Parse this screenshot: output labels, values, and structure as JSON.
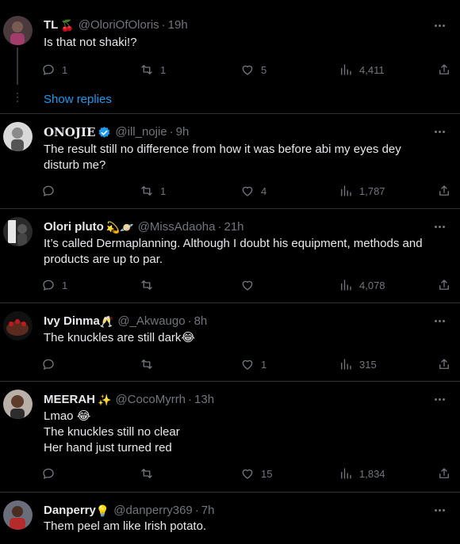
{
  "tweets": [
    {
      "name": "TL",
      "name_emoji": "🍒",
      "handle": "@OloriOfOloris",
      "time": "19h",
      "text_lines": [
        "Is that not shaki!?"
      ],
      "reply_count": "1",
      "retweet_count": "1",
      "like_count": "5",
      "view_count": "4,411",
      "show_replies": "Show replies"
    },
    {
      "name": "ONOJIE",
      "handle": "@ill_nojie",
      "time": "9h",
      "text_lines": [
        "The result still no difference from how it was before abi my eyes dey",
        "disturb me?"
      ],
      "reply_count": "",
      "retweet_count": "1",
      "like_count": "4",
      "view_count": "1,787"
    },
    {
      "name": "Olori pluto",
      "name_emoji": "💫🪐",
      "handle": "@MissAdaoha",
      "time": "21h",
      "text_lines": [
        "It’s called Dermaplanning. Although I doubt his equipment, methods and",
        "products are up to par."
      ],
      "reply_count": "1",
      "retweet_count": "",
      "like_count": "",
      "view_count": "4,078"
    },
    {
      "name": "Ivy Dinma",
      "name_emoji": "🥂",
      "handle": "@_Akwaugo",
      "time": "8h",
      "text_lines": [
        "The knuckles are still dark😂"
      ],
      "reply_count": "",
      "retweet_count": "",
      "like_count": "1",
      "view_count": "315"
    },
    {
      "name": "MEERAH",
      "name_emoji": "✨",
      "handle": "@CocoMyrrh",
      "time": "13h",
      "text_lines": [
        "Lmao 😂",
        "The knuckles still no clear",
        "Her hand just turned red"
      ],
      "reply_count": "",
      "retweet_count": "",
      "like_count": "15",
      "view_count": "1,834"
    },
    {
      "name": "Danperry",
      "name_emoji": "💡",
      "handle": "@danperry369",
      "time": "7h",
      "text_lines": [
        "Them peel am like Irish potato."
      ]
    }
  ],
  "colors": {
    "background": "#000000",
    "text": "#e7e9ea",
    "muted": "#71767b",
    "accent": "#1d9bf0",
    "border": "#2f3336"
  },
  "icons": [
    "reply-icon",
    "retweet-icon",
    "like-icon",
    "views-icon",
    "share-icon",
    "more-icon",
    "verified-badge-icon"
  ]
}
